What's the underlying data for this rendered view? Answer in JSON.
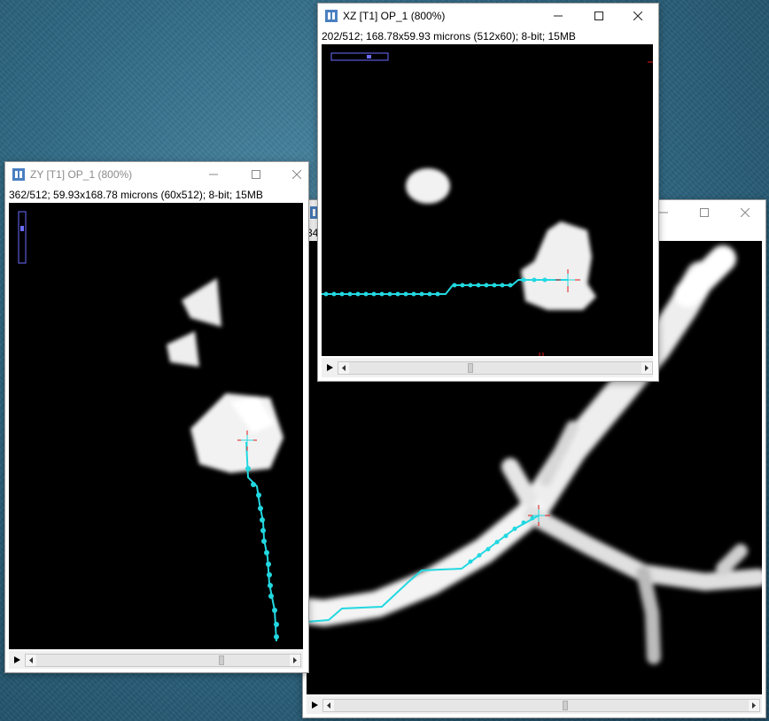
{
  "colors": {
    "trace": "#22d8e0",
    "cursor": "#e01818",
    "roi": "#6b6bff",
    "canvas": "#000000"
  },
  "window_main": {
    "title": "",
    "info_partial": "34"
  },
  "window_zy": {
    "title": "ZY [T1] OP_1 (800%)",
    "info": "362/512; 59.93x168.78 microns (60x512); 8-bit; 15MB"
  },
  "window_xz": {
    "title": "XZ [T1] OP_1 (800%)",
    "info": "202/512; 168.78x59.93 microns (512x60); 8-bit; 15MB"
  },
  "icons": {
    "app": "imagej-app-icon",
    "minimize": "minimize-icon",
    "maximize": "maximize-icon",
    "close": "close-icon",
    "play": "play-icon",
    "scroll_left": "scroll-left-arrow-icon",
    "scroll_right": "scroll-right-arrow-icon"
  }
}
